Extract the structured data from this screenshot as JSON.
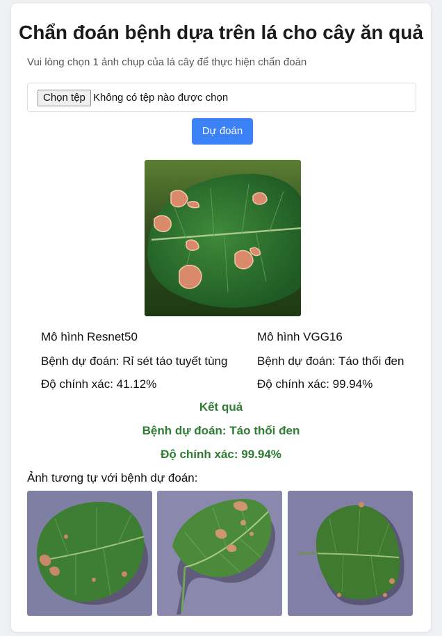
{
  "header": {
    "title": "Chẩn đoán bệnh dựa trên lá cho cây ăn quả",
    "subtitle": "Vui lòng chọn 1 ảnh chụp của lá cây để thực hiện chẩn đoán"
  },
  "upload": {
    "choose_label": "Chọn tệp",
    "status": "Không có tệp nào được chọn",
    "predict_label": "Dự đoán"
  },
  "models": [
    {
      "name": "Mô hình Resnet50",
      "disease": "Bệnh dự đoán: Rỉ sét táo tuyết tùng",
      "accuracy": "Độ chính xác: 41.12%"
    },
    {
      "name": "Mô hình VGG16",
      "disease": "Bệnh dự đoán: Táo thối đen",
      "accuracy": "Độ chính xác: 99.94%"
    }
  ],
  "result": {
    "heading": "Kết quả",
    "disease": "Bệnh dự đoán: Táo thối đen",
    "accuracy": "Độ chính xác: 99.94%"
  },
  "similar": {
    "title": "Ảnh tương tự với bệnh dự đoán:"
  },
  "colors": {
    "accent": "#3b82f6",
    "result_green": "#2e7d32"
  }
}
